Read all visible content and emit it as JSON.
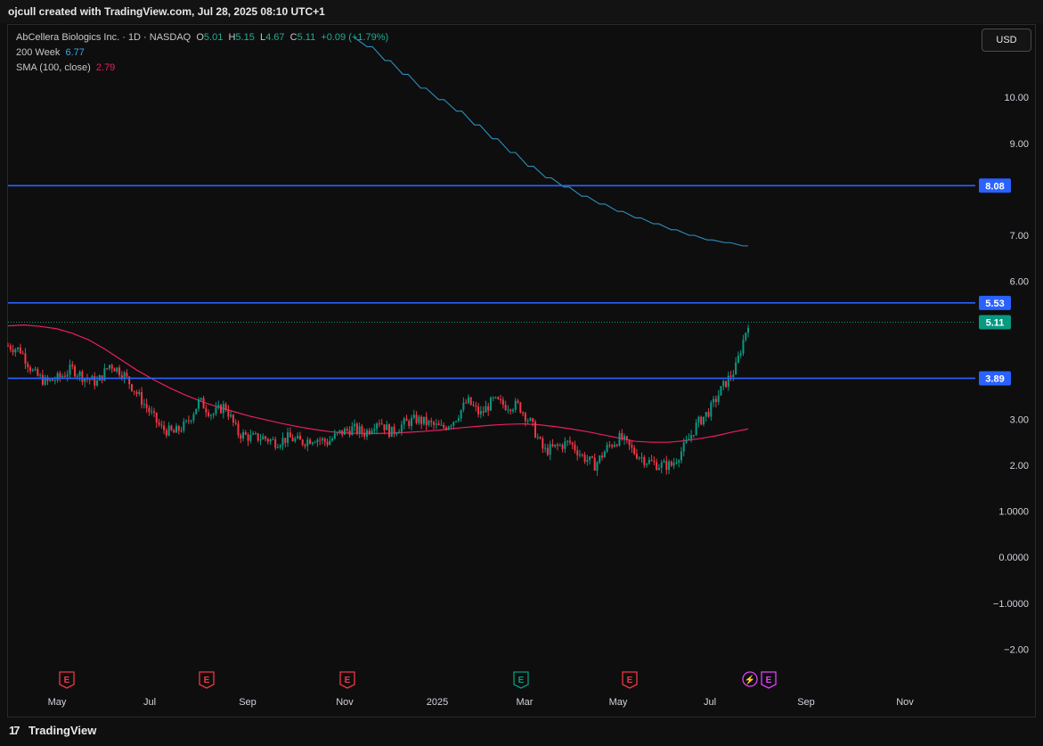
{
  "header": {
    "attribution": "ojcull created with TradingView.com, Jul 28, 2025 08:10 UTC+1"
  },
  "legend": {
    "symbol": "AbCellera Biologics Inc. · 1D · NASDAQ",
    "o_label": "O",
    "o_value": "5.01",
    "h_label": "H",
    "h_value": "5.15",
    "l_label": "L",
    "l_value": "4.67",
    "c_label": "C",
    "c_value": "5.11",
    "change": "+0.09 (+1.79%)",
    "ma200_label": "200 Week",
    "ma200_value": "6.77",
    "sma_label": "SMA (100, close)",
    "sma_value": "2.79"
  },
  "currency_button": "USD",
  "footer": {
    "brand": "TradingView"
  },
  "chart_data": {
    "type": "candlestick",
    "x_tick_labels": [
      "May",
      "Jul",
      "Sep",
      "Nov",
      "2025",
      "Mar",
      "May",
      "Jul",
      "Sep",
      "Nov"
    ],
    "y_tick_labels": [
      "10.00",
      "9.00",
      "7.00",
      "6.00",
      "3.00",
      "2.00",
      "1.0000",
      "0.0000",
      "−1.0000",
      "−2.00"
    ],
    "y_tick_values": [
      10,
      9,
      7,
      6,
      3,
      2,
      1,
      0,
      -1,
      -2
    ],
    "ylim": [
      -2.2,
      11.3
    ],
    "horizontal_lines": [
      {
        "value": 8.08,
        "label": "8.08",
        "color": "#2962ff"
      },
      {
        "value": 5.53,
        "label": "5.53",
        "color": "#2962ff"
      },
      {
        "value": 3.89,
        "label": "3.89",
        "color": "#2962ff"
      }
    ],
    "last_price": {
      "value": 5.11,
      "label": "5.11",
      "color": "#089981"
    },
    "ma200_week": [
      11.3,
      11.1,
      10.8,
      10.5,
      10.2,
      9.95,
      9.7,
      9.4,
      9.1,
      8.8,
      8.5,
      8.25,
      8.05,
      7.85,
      7.68,
      7.52,
      7.38,
      7.25,
      7.12,
      7.0,
      6.9,
      6.84,
      6.77
    ],
    "sma100": [
      5.03,
      5.05,
      5.02,
      4.97,
      4.87,
      4.73,
      4.53,
      4.3,
      4.07,
      3.87,
      3.69,
      3.53,
      3.39,
      3.27,
      3.17,
      3.07,
      2.99,
      2.91,
      2.84,
      2.78,
      2.73,
      2.7,
      2.69,
      2.69,
      2.7,
      2.72,
      2.74,
      2.77,
      2.81,
      2.84,
      2.87,
      2.89,
      2.9,
      2.88,
      2.84,
      2.79,
      2.73,
      2.66,
      2.59,
      2.52,
      2.5,
      2.5,
      2.53,
      2.58,
      2.64,
      2.72,
      2.79
    ],
    "closes": [
      4.6,
      4.5,
      4.0,
      3.8,
      3.9,
      4.1,
      3.9,
      3.8,
      4.2,
      4.0,
      3.6,
      3.2,
      2.8,
      2.7,
      2.9,
      3.4,
      3.1,
      3.3,
      2.7,
      2.6,
      2.6,
      2.5,
      2.6,
      2.5,
      2.6,
      2.5,
      2.7,
      2.8,
      2.7,
      3.0,
      2.7,
      2.9,
      3.0,
      2.9,
      2.8,
      3.0,
      3.4,
      3.1,
      3.4,
      3.3,
      3.3,
      2.9,
      2.3,
      2.4,
      2.5,
      2.2,
      2.0,
      2.4,
      2.6,
      2.3,
      2.1,
      2.0,
      2.0,
      2.4,
      2.9,
      3.2,
      3.7,
      4.1,
      5.11
    ]
  },
  "event_markers": [
    {
      "type": "earnings",
      "glyph": "E",
      "color": "#f23645"
    },
    {
      "type": "earnings",
      "glyph": "E",
      "color": "#f23645"
    },
    {
      "type": "earnings",
      "glyph": "E",
      "color": "#f23645"
    },
    {
      "type": "earnings",
      "glyph": "E",
      "color": "#089981"
    },
    {
      "type": "earnings",
      "glyph": "E",
      "color": "#f23645"
    },
    {
      "type": "split",
      "glyph": "⚡",
      "color": "#e040fb"
    },
    {
      "type": "earnings",
      "glyph": "E",
      "color": "#e040fb"
    }
  ]
}
